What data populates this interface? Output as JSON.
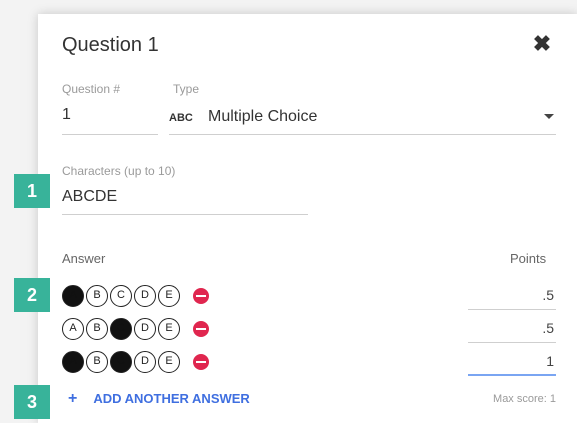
{
  "dialog": {
    "title": "Question 1",
    "close_icon": "close-icon",
    "question_number_label": "Question #",
    "question_number_value": "1",
    "type_label": "Type",
    "type_icon_text": "ABC",
    "type_value": "Multiple Choice",
    "characters_label": "Characters (up to 10)",
    "characters_value": "ABCDE",
    "answer_header": "Answer",
    "points_header": "Points",
    "answers": [
      {
        "bubbles": [
          {
            "letter": "A",
            "filled": true
          },
          {
            "letter": "B",
            "filled": false
          },
          {
            "letter": "C",
            "filled": false
          },
          {
            "letter": "D",
            "filled": false
          },
          {
            "letter": "E",
            "filled": false
          }
        ],
        "points": ".5"
      },
      {
        "bubbles": [
          {
            "letter": "A",
            "filled": false
          },
          {
            "letter": "B",
            "filled": false
          },
          {
            "letter": "C",
            "filled": true
          },
          {
            "letter": "D",
            "filled": false
          },
          {
            "letter": "E",
            "filled": false
          }
        ],
        "points": ".5"
      },
      {
        "bubbles": [
          {
            "letter": "A",
            "filled": true
          },
          {
            "letter": "B",
            "filled": false
          },
          {
            "letter": "C",
            "filled": true
          },
          {
            "letter": "D",
            "filled": false
          },
          {
            "letter": "E",
            "filled": false
          }
        ],
        "points": "1"
      }
    ],
    "add_answer_label": "ADD ANOTHER ANSWER",
    "max_score_label": "Max score: 1"
  },
  "badges": [
    "1",
    "2",
    "3"
  ],
  "colors": {
    "badge": "#38b39a",
    "accent": "#3f6fe0",
    "remove": "#e0264f"
  }
}
